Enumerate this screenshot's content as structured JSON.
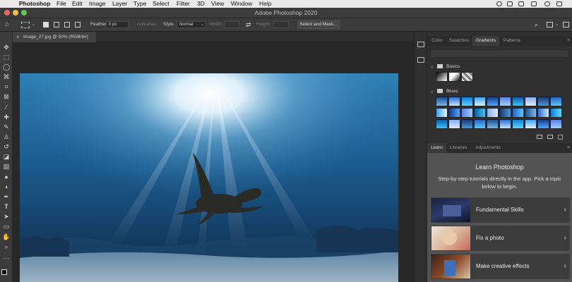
{
  "menubar": {
    "app_name": "Photoshop",
    "items": [
      "File",
      "Edit",
      "Image",
      "Layer",
      "Type",
      "Select",
      "Filter",
      "3D",
      "View",
      "Window",
      "Help"
    ]
  },
  "window": {
    "title": "Adobe Photoshop 2020"
  },
  "options": {
    "feather_label": "Feather:",
    "feather_value": "0 px",
    "antialias_label": "Anti-alias",
    "style_label": "Style:",
    "style_value": "Normal",
    "width_label": "Width:",
    "height_label": "Height:",
    "select_mask_label": "Select and Mask..."
  },
  "document": {
    "tab_label": "Image_27.jpg @ 50% (RGB/8#)",
    "close_glyph": "×"
  },
  "gradients_panel": {
    "tabs": [
      "Color",
      "Swatches",
      "Gradients",
      "Patterns"
    ],
    "active_tab": "Gradients",
    "groups": [
      "Basics",
      "Blues"
    ]
  },
  "learn_panel": {
    "tabs": [
      "Learn",
      "Libraries",
      "Adjustments"
    ],
    "active_tab": "Learn",
    "title": "Learn Photoshop",
    "description": "Step-by-step tutorials directly in the app. Pick a topic below to begin.",
    "cards": [
      {
        "label": "Fundamental Skills"
      },
      {
        "label": "Fix a photo"
      },
      {
        "label": "Make creative effects"
      }
    ]
  },
  "colors": {
    "menubar_bg": "#e9e9e9",
    "chrome_bg": "#3b3b3b",
    "panel_bg": "#535353",
    "close_light": "#ed6a5e",
    "minimize_light": "#f5bf4f",
    "zoom_light": "#61c554"
  }
}
